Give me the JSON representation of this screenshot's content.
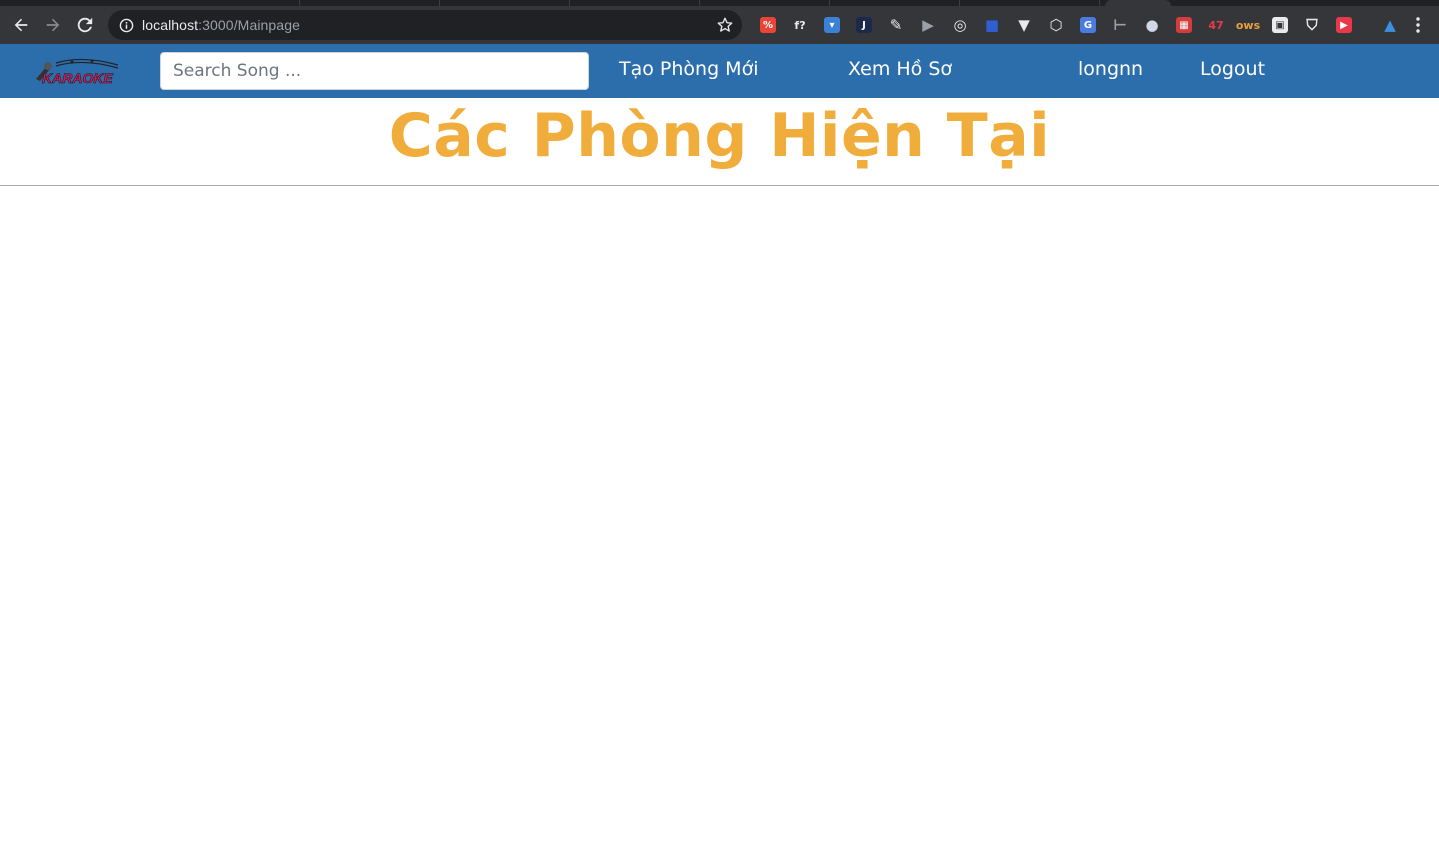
{
  "browser": {
    "url_host": "localhost",
    "url_path": ":3000/Mainpage",
    "extensions": [
      {
        "name": "ext-red-percent-icon",
        "bg": "#e94435",
        "glyph": "%"
      },
      {
        "name": "ext-font-question-icon",
        "bg": "",
        "glyph": "f?"
      },
      {
        "name": "ext-pocket-icon",
        "bg": "#3b82d6",
        "glyph": "▾"
      },
      {
        "name": "ext-j-icon",
        "bg": "#1c2a4a",
        "glyph": "J"
      },
      {
        "name": "ext-pen-badge-icon",
        "bg": "",
        "glyph": "✎"
      },
      {
        "name": "ext-play-icon",
        "bg": "",
        "glyph": "▶"
      },
      {
        "name": "ext-target-icon",
        "bg": "",
        "glyph": "◎"
      },
      {
        "name": "ext-square-icon",
        "bg": "",
        "glyph": "■"
      },
      {
        "name": "ext-vue-icon",
        "bg": "",
        "glyph": "▼"
      },
      {
        "name": "ext-cube-icon",
        "bg": "",
        "glyph": "⬡"
      },
      {
        "name": "ext-translate-icon",
        "bg": "#4a7be0",
        "glyph": "G"
      },
      {
        "name": "ext-bracket-icon",
        "bg": "",
        "glyph": "⊢"
      },
      {
        "name": "ext-circle-icon",
        "bg": "",
        "glyph": "●"
      },
      {
        "name": "ext-red-grid-icon",
        "bg": "#d33d3d",
        "glyph": "▦"
      },
      {
        "name": "ext-47-icon",
        "bg": "",
        "glyph": "47"
      },
      {
        "name": "ext-ows-icon",
        "bg": "",
        "glyph": "ows"
      },
      {
        "name": "ext-white-box-icon",
        "bg": "#e8eaed",
        "glyph": "▣"
      },
      {
        "name": "ext-shield-icon",
        "bg": "",
        "glyph": "⛉"
      },
      {
        "name": "ext-red-play-icon",
        "bg": "#e8394b",
        "glyph": "▶"
      },
      {
        "name": "ext-triangle-icon",
        "bg": "",
        "glyph": "▲"
      }
    ]
  },
  "navbar": {
    "logo_text": "KARAOKE",
    "search_placeholder": "Search Song ...",
    "links": {
      "create_room": "Tạo Phòng Mới",
      "view_profile": "Xem Hồ Sơ",
      "username": "longnn",
      "logout": "Logout"
    },
    "bg_color": "#2c6dab"
  },
  "main": {
    "heading": "Các Phòng Hiện Tại",
    "heading_color": "#f0ad3c"
  }
}
